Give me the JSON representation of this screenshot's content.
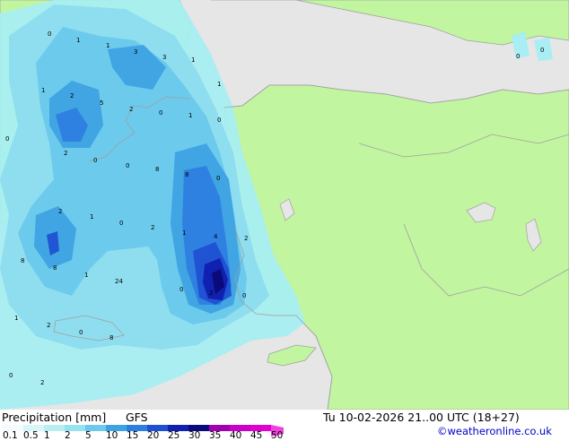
{
  "map": {
    "colors": {
      "sea": "#e6e6e6",
      "land": "#c2f5a0",
      "border": "#a0a0a0",
      "precip_levels": [
        "#a8eef2",
        "#8ddcee",
        "#6ac8ec",
        "#3ea2e2",
        "#2e7ee0",
        "#1f50d2",
        "#1020b0",
        "#0a0a78"
      ]
    },
    "labels": [
      "0",
      "1",
      "1",
      "3",
      "3",
      "1",
      "1",
      "2",
      "5",
      "2",
      "0",
      "1",
      "0",
      "0",
      "2",
      "0",
      "0",
      "8",
      "8",
      "0",
      "2",
      "1",
      "0",
      "2",
      "1",
      "4",
      "2",
      "8",
      "8",
      "1",
      "24",
      "2",
      "0",
      "1",
      "2",
      "0",
      "8",
      "0",
      "2",
      "0",
      "0",
      "0",
      "1"
    ]
  },
  "footer": {
    "title": "Precipitation [mm]",
    "model": "GFS",
    "datetime": "Tu 10-02-2026 21..00 UTC (18+27)",
    "credit": "©weatheronline.co.uk",
    "scale_values": [
      "0.1",
      "0.5",
      "1",
      "2",
      "5",
      "10",
      "15",
      "20",
      "25",
      "30",
      "35",
      "40",
      "45",
      "50"
    ],
    "scale_colors": [
      "#f5fbfd",
      "#d8f6f8",
      "#b8eef2",
      "#96e2f0",
      "#6ec8ec",
      "#3ea2e2",
      "#2e7ee0",
      "#1f50d2",
      "#1020b0",
      "#0a0a78",
      "#a000b0",
      "#c800c8",
      "#e000d0",
      "#f040e0"
    ]
  }
}
